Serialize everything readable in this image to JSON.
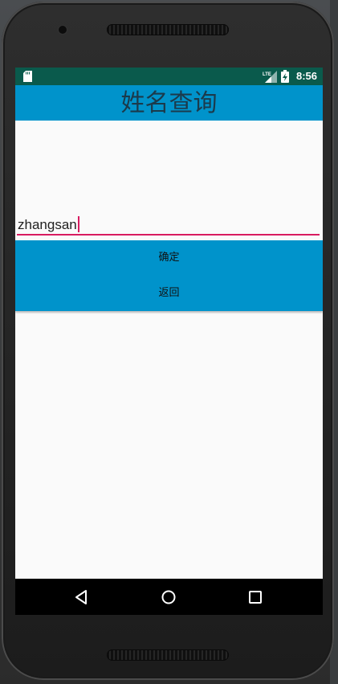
{
  "status_bar": {
    "time": "8:56",
    "network": "LTE",
    "sd_icon": "sd-card-icon",
    "signal_icon": "lte-signal-icon",
    "battery_icon": "battery-charging-icon",
    "background_color": "#0a5a4c"
  },
  "app_bar": {
    "title": "姓名查询",
    "background_color": "#0093cb"
  },
  "form": {
    "name_input_value": "zhangsan",
    "accent_color": "#d81b60"
  },
  "buttons": {
    "confirm_label": "确定",
    "back_label": "返回",
    "background_color": "#0093cb"
  },
  "nav_bar": {
    "back_icon": "nav-back-triangle-icon",
    "home_icon": "nav-home-circle-icon",
    "recents_icon": "nav-recents-square-icon"
  }
}
